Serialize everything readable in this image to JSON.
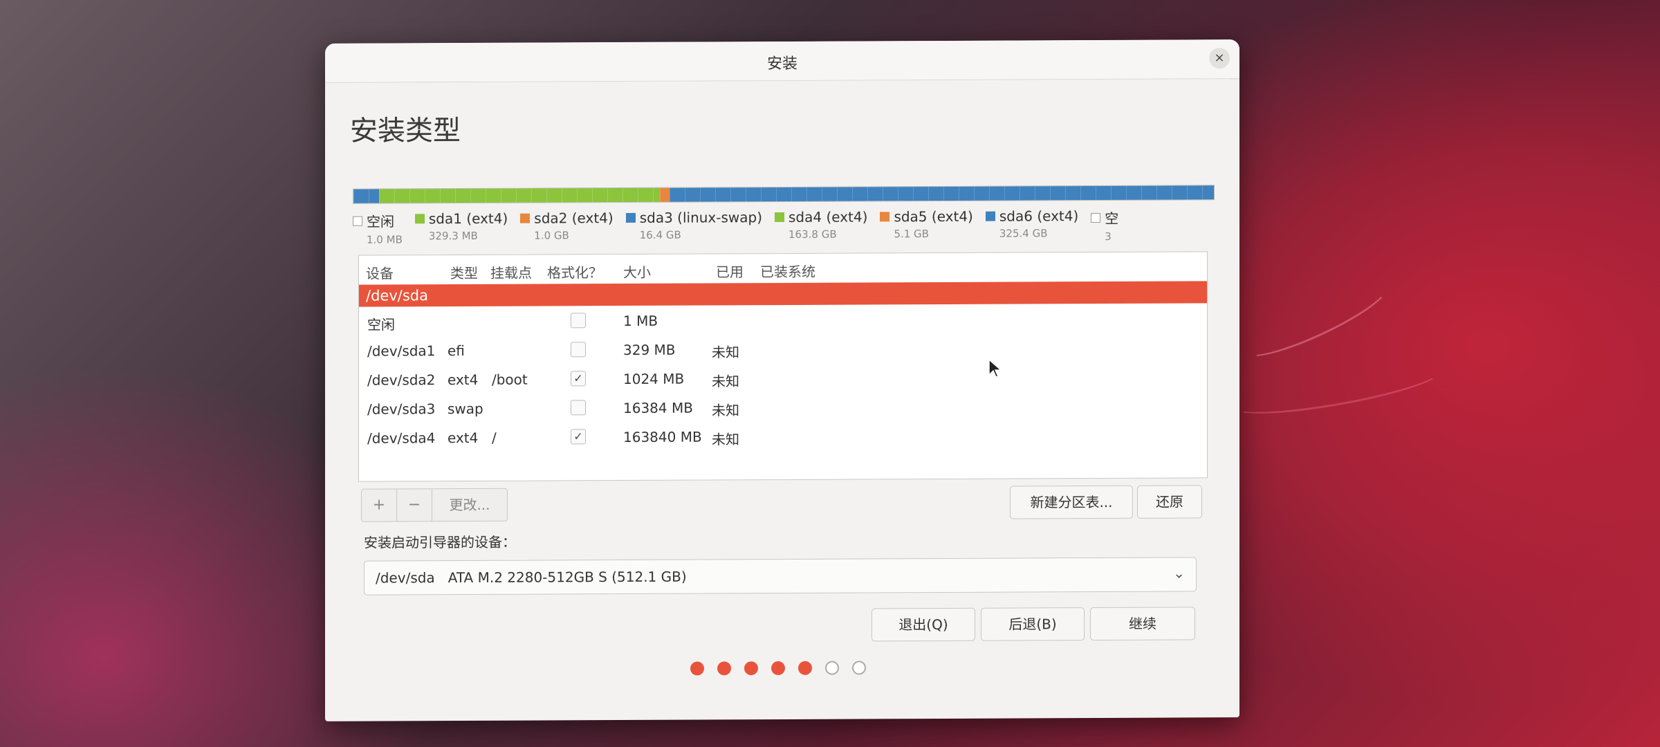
{
  "window": {
    "title": "安装"
  },
  "page": {
    "heading": "安装类型"
  },
  "partition_bar": [
    {
      "color": "#3f82bd",
      "flex": 0.3
    },
    {
      "color": "#8cc43c",
      "flex": 3.3
    },
    {
      "color": "#e8863c",
      "flex": 0.12
    },
    {
      "color": "#3f82bd",
      "flex": 6.4
    }
  ],
  "legend": [
    {
      "name": "空闲",
      "size": "1.0 MB",
      "color": "#ffffff",
      "free": true
    },
    {
      "name": "sda1 (ext4)",
      "size": "329.3 MB",
      "color": "#8cc43c"
    },
    {
      "name": "sda2 (ext4)",
      "size": "1.0 GB",
      "color": "#e8863c"
    },
    {
      "name": "sda3 (linux-swap)",
      "size": "16.4 GB",
      "color": "#3f82bd"
    },
    {
      "name": "sda4 (ext4)",
      "size": "163.8 GB",
      "color": "#8cc43c"
    },
    {
      "name": "sda5 (ext4)",
      "size": "5.1 GB",
      "color": "#e8863c"
    },
    {
      "name": "sda6 (ext4)",
      "size": "325.4 GB",
      "color": "#3f82bd"
    },
    {
      "name": "空",
      "size": "3",
      "color": "#ffffff",
      "free": true
    }
  ],
  "table": {
    "headers": {
      "device": "设备",
      "type": "类型",
      "mount": "挂载点",
      "format": "格式化？",
      "size": "大小",
      "used": "已用",
      "system": "已装系统"
    },
    "disk": "/dev/sda",
    "rows": [
      {
        "device": "空闲",
        "type": "",
        "mount": "",
        "format": false,
        "size": "1 MB",
        "used": ""
      },
      {
        "device": "/dev/sda1",
        "type": "efi",
        "mount": "",
        "format": false,
        "size": "329 MB",
        "used": "未知"
      },
      {
        "device": "/dev/sda2",
        "type": "ext4",
        "mount": "/boot",
        "format": true,
        "size": "1024 MB",
        "used": "未知"
      },
      {
        "device": "/dev/sda3",
        "type": "swap",
        "mount": "",
        "format": false,
        "size": "16384 MB",
        "used": "未知"
      },
      {
        "device": "/dev/sda4",
        "type": "ext4",
        "mount": "/",
        "format": true,
        "size": "163840 MB",
        "used": "未知"
      }
    ]
  },
  "toolbar": {
    "add": "+",
    "remove": "−",
    "change": "更改...",
    "new_table": "新建分区表...",
    "revert": "还原"
  },
  "bootloader": {
    "label": "安装启动引导器的设备：",
    "device": "/dev/sda",
    "description": "ATA M.2 2280-512GB S (512.1 GB)"
  },
  "buttons": {
    "quit": "退出(Q)",
    "back": "后退(B)",
    "continue": "继续"
  },
  "progress": {
    "total": 7,
    "current": 5
  }
}
